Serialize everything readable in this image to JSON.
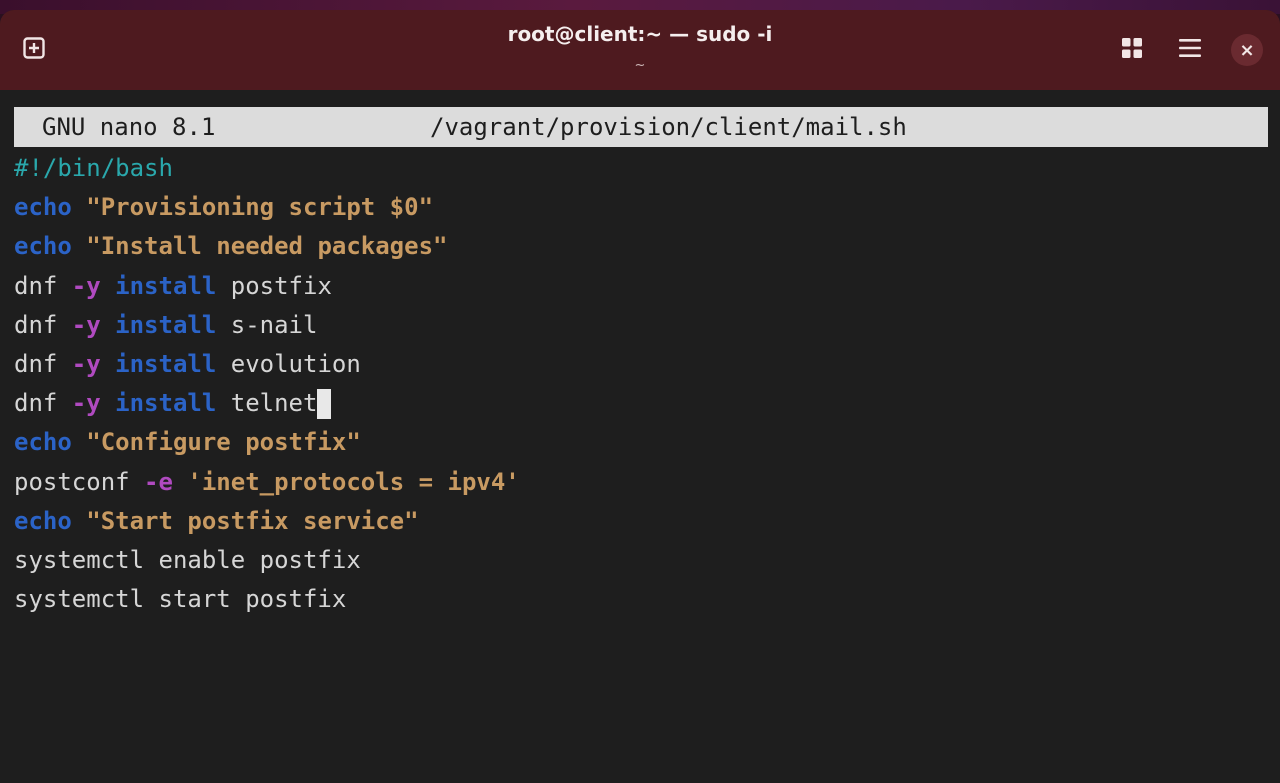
{
  "window": {
    "title": "root@client:~ — sudo -i",
    "subtitle": "~",
    "icons": {
      "new_tab": "new-tab-icon",
      "grid": "grid-view-icon",
      "menu": "hamburger-menu-icon",
      "close": "close-icon"
    },
    "close_glyph": "×"
  },
  "nano": {
    "version": "GNU nano 8.1",
    "filename": "/vagrant/provision/client/mail.sh"
  },
  "colors": {
    "titlebar": "#4e1a1f",
    "terminal_bg": "#1e1e1e",
    "comment": "#2aa8ac",
    "builtin": "#2b63c7",
    "string": "#c89a62",
    "flag": "#b04ac0",
    "plain": "#d6d6d6"
  },
  "lines": [
    [
      {
        "t": "comment",
        "v": "#!/bin/bash"
      }
    ],
    [
      {
        "t": "builtin",
        "v": "echo"
      },
      {
        "t": "plain",
        "v": " "
      },
      {
        "t": "string",
        "v": "\"Provisioning script $0\""
      }
    ],
    [
      {
        "t": "builtin",
        "v": "echo"
      },
      {
        "t": "plain",
        "v": " "
      },
      {
        "t": "string",
        "v": "\"Install needed packages\""
      }
    ],
    [
      {
        "t": "plain",
        "v": "dnf "
      },
      {
        "t": "flag",
        "v": "-y"
      },
      {
        "t": "plain",
        "v": " "
      },
      {
        "t": "builtin",
        "v": "install"
      },
      {
        "t": "plain",
        "v": " postfix"
      }
    ],
    [
      {
        "t": "plain",
        "v": "dnf "
      },
      {
        "t": "flag",
        "v": "-y"
      },
      {
        "t": "plain",
        "v": " "
      },
      {
        "t": "builtin",
        "v": "install"
      },
      {
        "t": "plain",
        "v": " s-nail"
      }
    ],
    [
      {
        "t": "plain",
        "v": "dnf "
      },
      {
        "t": "flag",
        "v": "-y"
      },
      {
        "t": "plain",
        "v": " "
      },
      {
        "t": "builtin",
        "v": "install"
      },
      {
        "t": "plain",
        "v": " evolution"
      }
    ],
    [
      {
        "t": "plain",
        "v": "dnf "
      },
      {
        "t": "flag",
        "v": "-y"
      },
      {
        "t": "plain",
        "v": " "
      },
      {
        "t": "builtin",
        "v": "install"
      },
      {
        "t": "plain",
        "v": " telnet"
      },
      {
        "t": "cursor",
        "v": ""
      }
    ],
    [
      {
        "t": "builtin",
        "v": "echo"
      },
      {
        "t": "plain",
        "v": " "
      },
      {
        "t": "string",
        "v": "\"Configure postfix\""
      }
    ],
    [
      {
        "t": "plain",
        "v": "postconf "
      },
      {
        "t": "flag",
        "v": "-e"
      },
      {
        "t": "plain",
        "v": " "
      },
      {
        "t": "string",
        "v": "'inet_protocols = ipv4'"
      }
    ],
    [
      {
        "t": "builtin",
        "v": "echo"
      },
      {
        "t": "plain",
        "v": " "
      },
      {
        "t": "string",
        "v": "\"Start postfix service\""
      }
    ],
    [
      {
        "t": "plain",
        "v": "systemctl enable postfix"
      }
    ],
    [
      {
        "t": "plain",
        "v": "systemctl start postfix"
      }
    ]
  ]
}
